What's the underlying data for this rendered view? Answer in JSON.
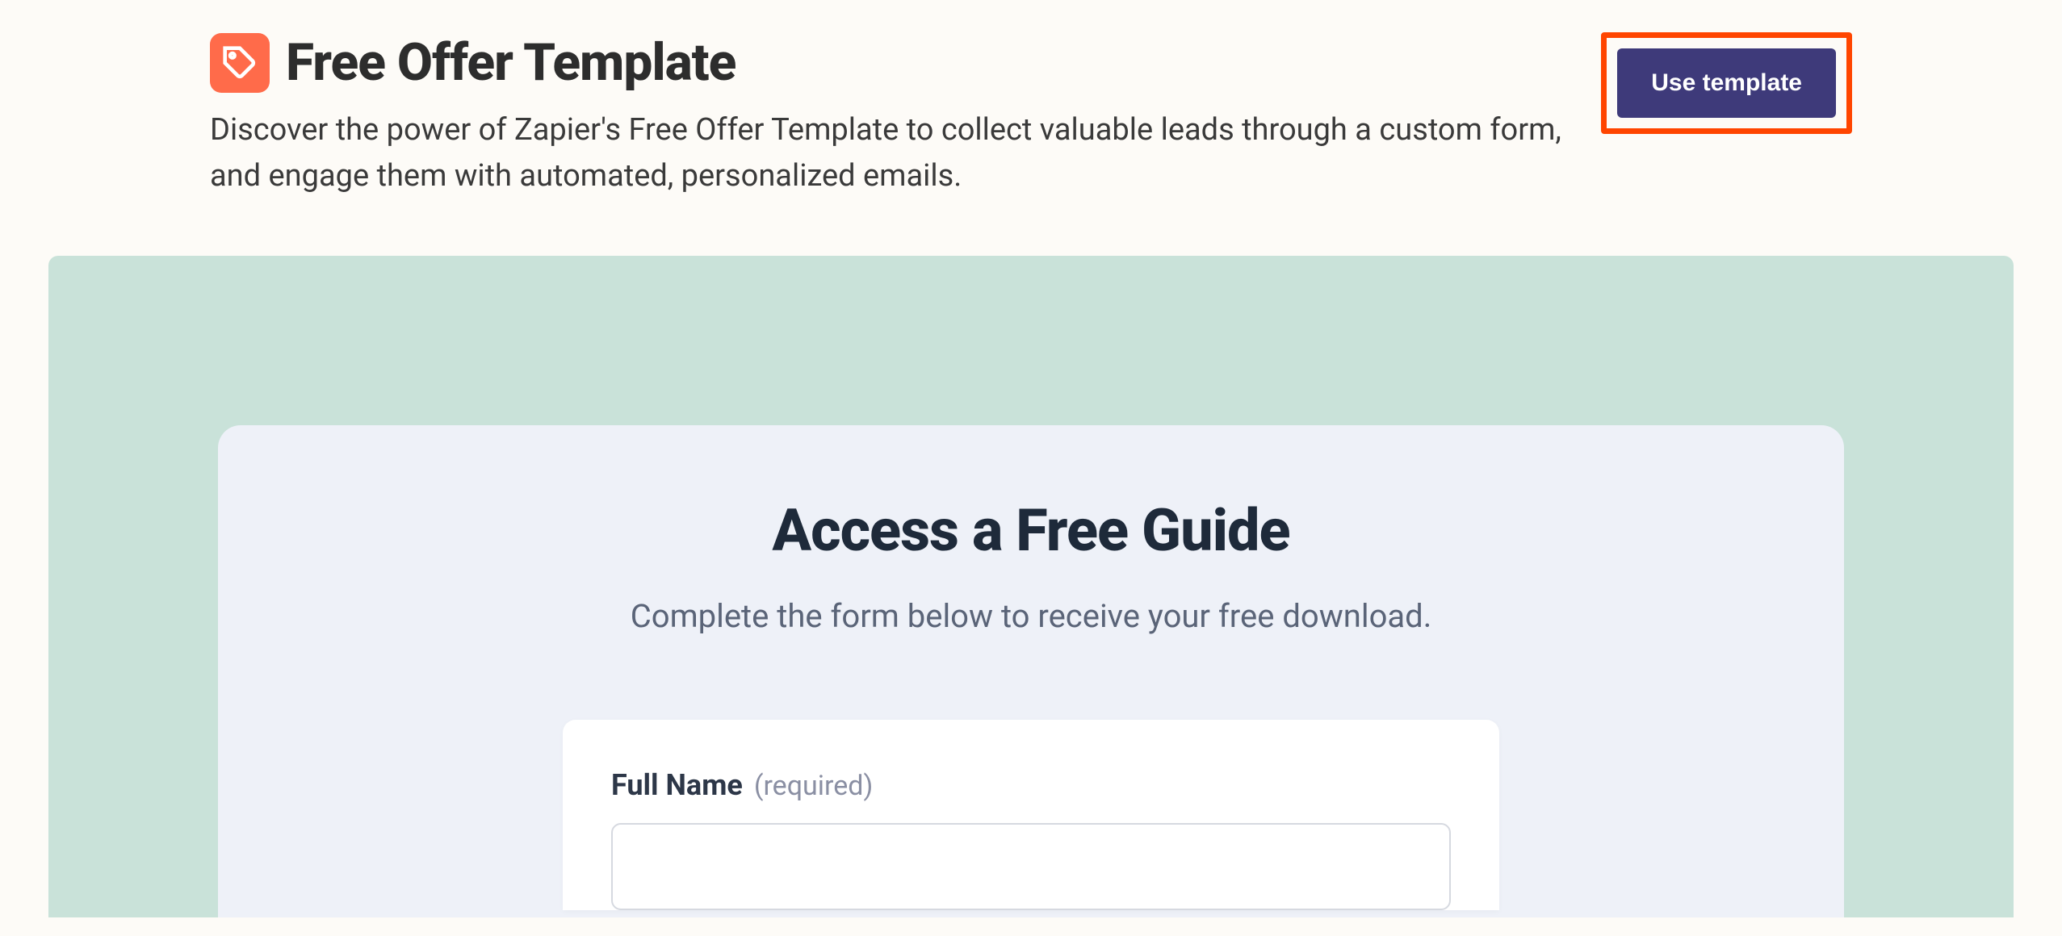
{
  "header": {
    "icon": "tag-icon",
    "title": "Free Offer Template",
    "description": "Discover the power of Zapier's Free Offer Template to collect valuable leads through a custom form, and engage them with automated, personalized emails."
  },
  "cta": {
    "label": "Use template"
  },
  "preview": {
    "form_title": "Access a Free Guide",
    "form_subtitle": "Complete the form below to receive your free download.",
    "fields": [
      {
        "label": "Full Name",
        "required_text": "(required)",
        "value": ""
      }
    ]
  }
}
